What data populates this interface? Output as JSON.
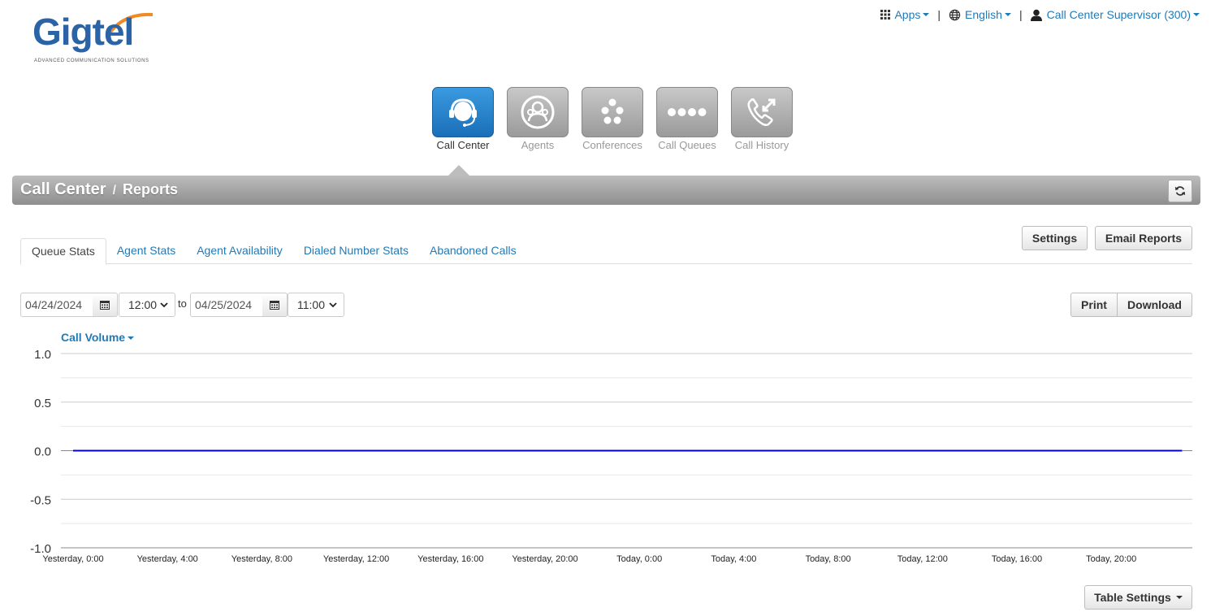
{
  "logo": {
    "name": "Gigtel",
    "tagline": "ADVANCED COMMUNICATION SOLUTIONS"
  },
  "topnav": {
    "apps": "Apps",
    "language": "English",
    "user": "Call Center Supervisor (300)",
    "separator": "|"
  },
  "apps": [
    {
      "label": "Call Center",
      "icon": "headset-icon",
      "active": true
    },
    {
      "label": "Agents",
      "icon": "agents-icon",
      "active": false
    },
    {
      "label": "Conferences",
      "icon": "conference-icon",
      "active": false
    },
    {
      "label": "Call Queues",
      "icon": "queue-icon",
      "active": false
    },
    {
      "label": "Call History",
      "icon": "call-history-icon",
      "active": false
    }
  ],
  "breadcrumb": {
    "section": "Call Center",
    "separator": "/",
    "page": "Reports"
  },
  "actions": {
    "settings": "Settings",
    "email_reports": "Email Reports"
  },
  "tabs": [
    {
      "label": "Queue Stats",
      "active": true
    },
    {
      "label": "Agent Stats",
      "active": false
    },
    {
      "label": "Agent Availability",
      "active": false
    },
    {
      "label": "Dialed Number Stats",
      "active": false
    },
    {
      "label": "Abandoned Calls",
      "active": false
    }
  ],
  "date_range": {
    "start_date": "04/24/2024",
    "start_time": "12:00",
    "to": "to",
    "end_date": "04/25/2024",
    "end_time": "11:00"
  },
  "export": {
    "print": "Print",
    "download": "Download"
  },
  "chart_selector": "Call Volume",
  "table_settings": "Table Settings",
  "colors": {
    "accent": "#1f7ab8",
    "active_app": "#2a86cf",
    "series": "#0000cc"
  },
  "chart_data": {
    "type": "line",
    "title": "",
    "xlabel": "",
    "ylabel": "",
    "ylim": [
      -1.0,
      1.0
    ],
    "y_ticks": [
      "1.0",
      "0.5",
      "0.0",
      "-0.5",
      "-1.0"
    ],
    "y_tick_values": [
      1.0,
      0.5,
      0.0,
      -0.5,
      -1.0
    ],
    "x_tick_labels": [
      "Yesterday, 0:00",
      "Yesterday, 4:00",
      "Yesterday, 8:00",
      "Yesterday, 12:00",
      "Yesterday, 16:00",
      "Yesterday, 20:00",
      "Today, 0:00",
      "Today, 4:00",
      "Today, 8:00",
      "Today, 12:00",
      "Today, 16:00",
      "Today, 20:00"
    ],
    "x_tick_hours": [
      0,
      4,
      8,
      12,
      16,
      20,
      24,
      28,
      32,
      36,
      40,
      44
    ],
    "grid": true,
    "series": [
      {
        "x_hours": [
          0,
          47
        ],
        "values": [
          0,
          0
        ]
      }
    ]
  }
}
